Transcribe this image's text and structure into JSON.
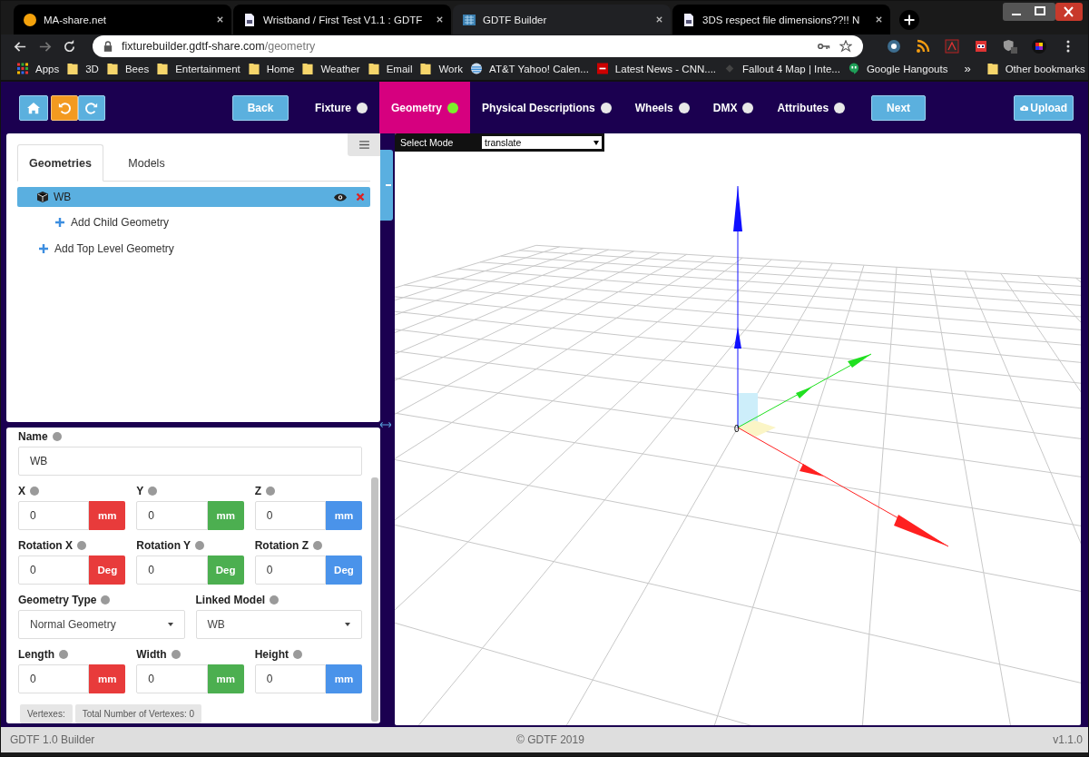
{
  "browser": {
    "tabs": [
      {
        "title": "MA-share.net",
        "kind": "site",
        "selected": false
      },
      {
        "title": "Wristband / First Test V1.1 : GDTF",
        "kind": "page",
        "selected": false
      },
      {
        "title": "GDTF Builder",
        "kind": "builder",
        "selected": true
      },
      {
        "title": "3DS respect file dimensions??!! N",
        "kind": "page",
        "selected": false
      }
    ],
    "url_host": "fixturebuilder.gdtf-share.com",
    "url_path": "/geometry",
    "bookmarks": [
      {
        "label": "Apps",
        "kind": "apps"
      },
      {
        "label": "3D",
        "kind": "folder"
      },
      {
        "label": "Bees",
        "kind": "folder"
      },
      {
        "label": "Entertainment",
        "kind": "folder"
      },
      {
        "label": "Home",
        "kind": "folder"
      },
      {
        "label": "Weather",
        "kind": "folder"
      },
      {
        "label": "Email",
        "kind": "folder"
      },
      {
        "label": "Work",
        "kind": "folder"
      },
      {
        "label": "AT&T Yahoo! Calen...",
        "kind": "globe"
      },
      {
        "label": "Latest News - CNN....",
        "kind": "news"
      },
      {
        "label": "Fallout 4 Map | Inte...",
        "kind": "blank"
      },
      {
        "label": "Google Hangouts",
        "kind": "chat"
      }
    ],
    "more": "»",
    "other_bookmarks": "Other bookmarks"
  },
  "header": {
    "back": "Back",
    "next": "Next",
    "upload": "Upload",
    "steps": [
      {
        "label": "Fixture",
        "selected": false
      },
      {
        "label": "Geometry",
        "selected": true
      },
      {
        "label": "Physical Descriptions",
        "selected": false
      },
      {
        "label": "Wheels",
        "selected": false
      },
      {
        "label": "DMX",
        "selected": false
      },
      {
        "label": "Attributes",
        "selected": false
      }
    ]
  },
  "panel": {
    "tabs": [
      {
        "label": "Geometries",
        "selected": true
      },
      {
        "label": "Models",
        "selected": false
      }
    ],
    "tree": [
      {
        "label": "WB",
        "selected": true
      }
    ],
    "add_child": "Add Child Geometry",
    "add_top": "Add Top Level Geometry"
  },
  "form": {
    "name": {
      "label": "Name",
      "value": "WB"
    },
    "rows": [
      {
        "kind": "inputs",
        "fields": [
          {
            "label": "X",
            "value": "0",
            "unit": "mm",
            "color": "#e83b3b"
          },
          {
            "label": "Y",
            "value": "0",
            "unit": "mm",
            "color": "#4caf50"
          },
          {
            "label": "Z",
            "value": "0",
            "unit": "mm",
            "color": "#4a93ea"
          }
        ]
      },
      {
        "kind": "inputs",
        "fields": [
          {
            "label": "Rotation X",
            "value": "0",
            "unit": "Deg",
            "color": "#e83b3b"
          },
          {
            "label": "Rotation Y",
            "value": "0",
            "unit": "Deg",
            "color": "#4caf50"
          },
          {
            "label": "Rotation Z",
            "value": "0",
            "unit": "Deg",
            "color": "#4a93ea"
          }
        ]
      },
      {
        "kind": "selects",
        "fields": [
          {
            "label": "Geometry Type",
            "value": "Normal Geometry"
          },
          {
            "label": "Linked Model",
            "value": "WB"
          }
        ]
      },
      {
        "kind": "inputs",
        "fields": [
          {
            "label": "Length",
            "value": "0",
            "unit": "mm",
            "color": "#e83b3b"
          },
          {
            "label": "Width",
            "value": "0",
            "unit": "mm",
            "color": "#4caf50"
          },
          {
            "label": "Height",
            "value": "0",
            "unit": "mm",
            "color": "#4a93ea"
          }
        ]
      }
    ],
    "badges": [
      "Vertexes:",
      "Total Number of Vertexes: 0"
    ]
  },
  "viewport": {
    "select_mode": {
      "label": "Select Mode",
      "value": "translate"
    },
    "origin_label": "0"
  },
  "footer": {
    "left": "GDTF 1.0 Builder",
    "center": "© GDTF 2019",
    "right": "v1.1.0"
  }
}
